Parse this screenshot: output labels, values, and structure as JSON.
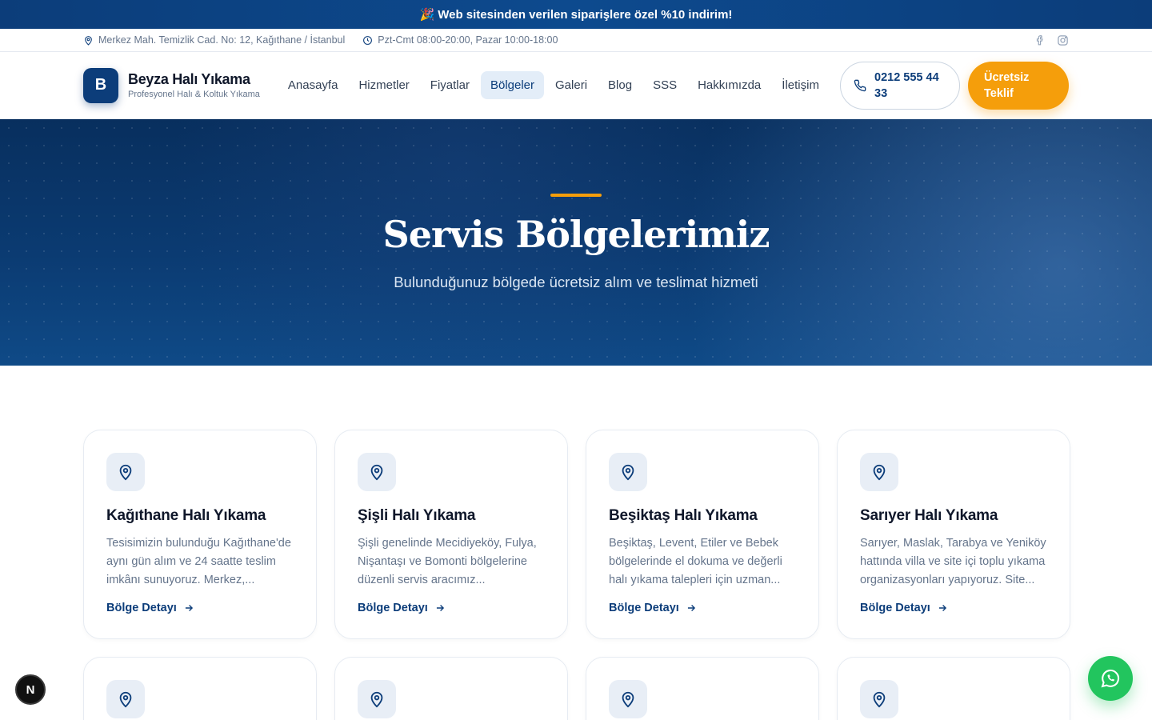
{
  "promo": {
    "emoji": "🎉",
    "text": "Web sitesinden verilen siparişlere özel %10 indirim!"
  },
  "infobar": {
    "address": "Merkez Mah. Temizlik Cad. No: 12, Kağıthane / İstanbul",
    "hours": "Pzt-Cmt 08:00-20:00, Pazar 10:00-18:00"
  },
  "brand": {
    "initial": "B",
    "title": "Beyza Halı Yıkama",
    "subtitle": "Profesyonel Halı & Koltuk Yıkama"
  },
  "nav": [
    "Anasayfa",
    "Hizmetler",
    "Fiyatlar",
    "Bölgeler",
    "Galeri",
    "Blog",
    "SSS",
    "Hakkımızda",
    "İletişim"
  ],
  "nav_active": "Bölgeler",
  "actions": {
    "phone_line1": "0212 555 44",
    "phone_line2": "33",
    "quote_line1": "Ücretsiz",
    "quote_line2": "Teklif"
  },
  "hero": {
    "title": "Servis Bölgelerimiz",
    "subtitle": "Bulunduğunuz bölgede ücretsiz alım ve teslimat hizmeti"
  },
  "regions": [
    {
      "name": "Kağıthane Halı Yıkama",
      "desc": "Tesisimizin bulunduğu Kağıthane'de aynı gün alım ve 24 saatte teslim imkânı sunuyoruz. Merkez,...",
      "link": "Bölge Detayı"
    },
    {
      "name": "Şişli Halı Yıkama",
      "desc": "Şişli genelinde Mecidiyeköy, Fulya, Nişantaşı ve Bomonti bölgelerine düzenli servis aracımız...",
      "link": "Bölge Detayı"
    },
    {
      "name": "Beşiktaş Halı Yıkama",
      "desc": "Beşiktaş, Levent, Etiler ve Bebek bölgelerinde el dokuma ve değerli halı yıkama talepleri için uzman...",
      "link": "Bölge Detayı"
    },
    {
      "name": "Sarıyer Halı Yıkama",
      "desc": "Sarıyer, Maslak, Tarabya ve Yeniköy hattında villa ve site içi toplu yıkama organizasyonları yapıyoruz. Site...",
      "link": "Bölge Detayı"
    }
  ],
  "colors": {
    "primary": "#0c3d7a",
    "accent": "#f59e0b",
    "whatsapp": "#22c55e"
  },
  "icons": {
    "location": "map-pin-icon",
    "clock": "clock-icon",
    "facebook": "facebook-icon",
    "instagram": "instagram-icon",
    "phone": "phone-icon",
    "arrow": "arrow-right-icon",
    "whatsapp": "whatsapp-icon"
  },
  "next_badge": "N"
}
